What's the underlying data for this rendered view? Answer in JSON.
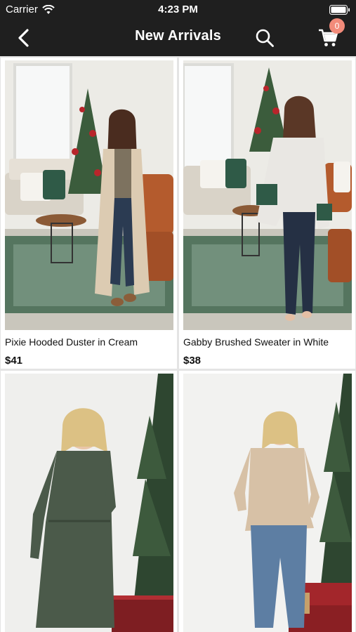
{
  "status_bar": {
    "carrier": "Carrier",
    "time": "4:23 PM"
  },
  "nav": {
    "title": "New Arrivals",
    "cart_count": "0",
    "icons": {
      "back": "chevron-left-icon",
      "search": "search-icon",
      "cart": "cart-icon"
    }
  },
  "products": [
    {
      "name": "Pixie Hooded Duster in Cream",
      "price": "$41"
    },
    {
      "name": "Gabby Brushed Sweater in White",
      "price": "$38"
    },
    {
      "name": "",
      "price": ""
    },
    {
      "name": "",
      "price": ""
    }
  ],
  "colors": {
    "nav_bg": "#1f1f1f",
    "badge": "#f28b7a",
    "grid_bg": "#e4e4e4"
  }
}
